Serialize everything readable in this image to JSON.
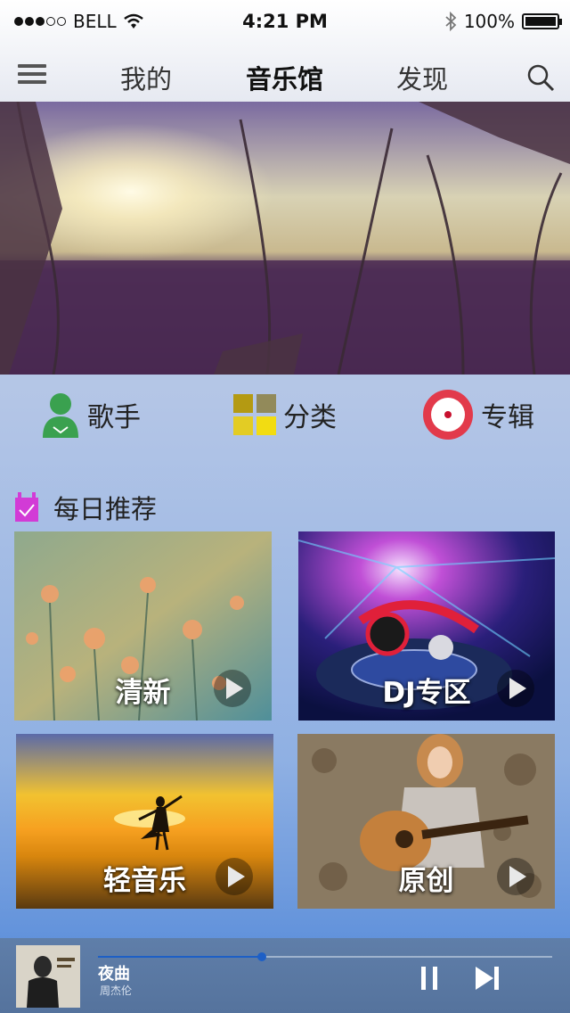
{
  "status_bar": {
    "carrier": "BELL",
    "time": "4:21 PM",
    "battery": "100%"
  },
  "nav": {
    "tabs": [
      {
        "label": "我的",
        "active": false
      },
      {
        "label": "音乐馆",
        "active": true
      },
      {
        "label": "发现",
        "active": false
      }
    ]
  },
  "quick": {
    "items": [
      {
        "label": "歌手",
        "icon": "singer-icon"
      },
      {
        "label": "分类",
        "icon": "category-grid-icon"
      },
      {
        "label": "专辑",
        "icon": "album-disc-icon"
      }
    ]
  },
  "daily": {
    "title": "每日推荐",
    "cards": [
      {
        "label": "清新"
      },
      {
        "label": "DJ专区"
      },
      {
        "label": "轻音乐"
      },
      {
        "label": "原创"
      }
    ]
  },
  "player": {
    "song_title": "夜曲",
    "artist": "周杰伦",
    "progress": 0.36
  },
  "colors": {
    "accent_blue": "#1d5fc6",
    "album_red": "#e23a4b",
    "singer_green": "#3aa14f",
    "calendar_magenta": "#d23bd6"
  }
}
